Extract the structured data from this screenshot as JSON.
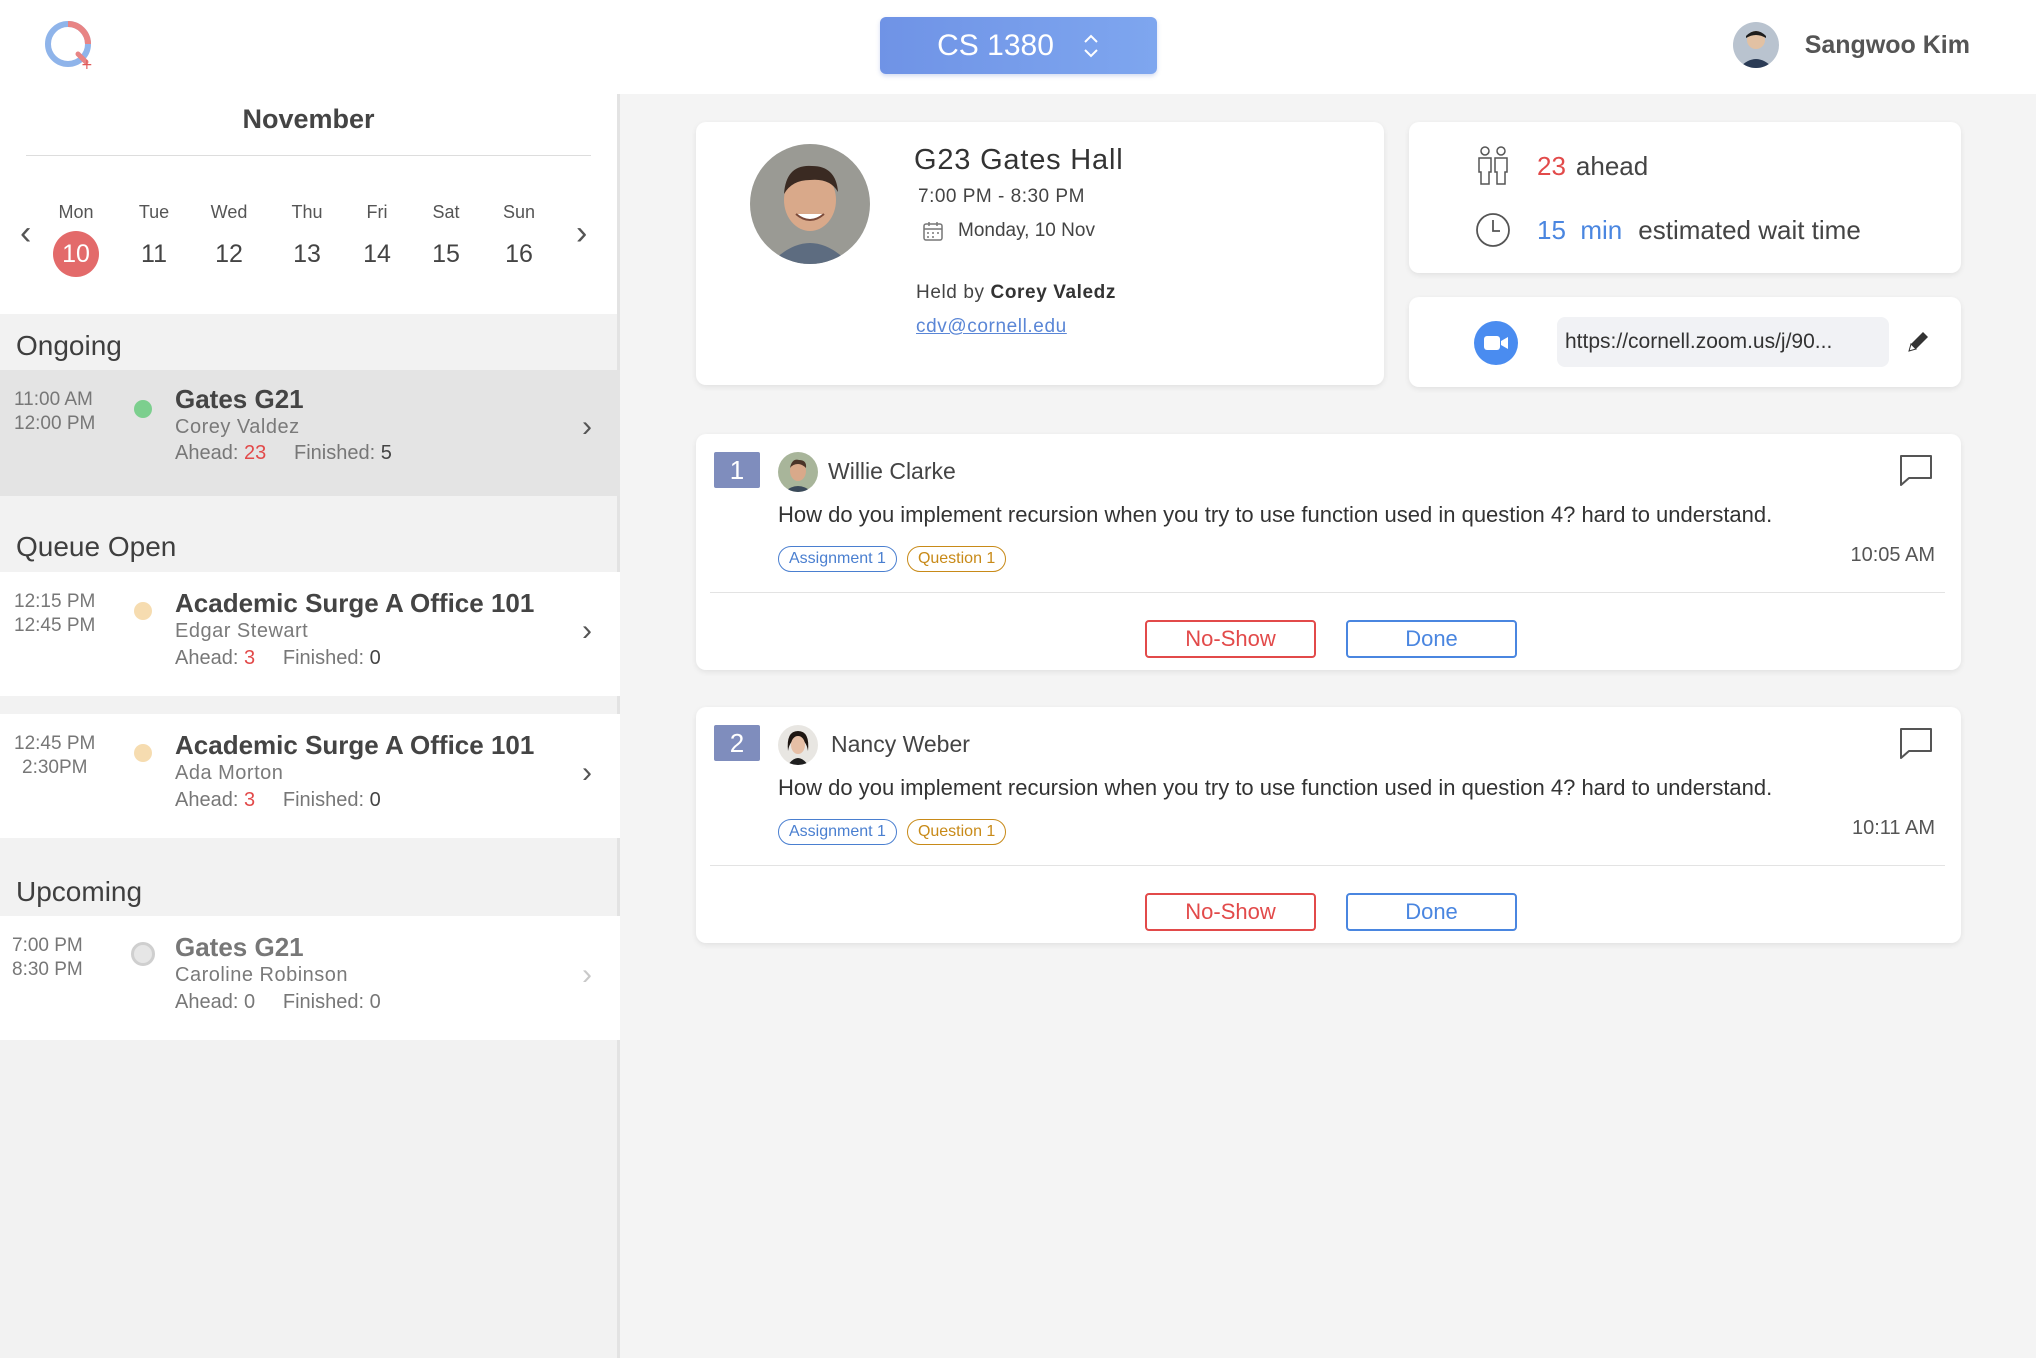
{
  "header": {
    "course": "CS 1380",
    "user_name": "Sangwoo Kim"
  },
  "calendar": {
    "month": "November",
    "days": [
      {
        "name": "Mon",
        "date": "10",
        "selected": true
      },
      {
        "name": "Tue",
        "date": "11"
      },
      {
        "name": "Wed",
        "date": "12"
      },
      {
        "name": "Thu",
        "date": "13"
      },
      {
        "name": "Fri",
        "date": "14"
      },
      {
        "name": "Sat",
        "date": "15"
      },
      {
        "name": "Sun",
        "date": "16"
      }
    ]
  },
  "sections": {
    "ongoing": "Ongoing",
    "queue_open": "Queue Open",
    "upcoming": "Upcoming"
  },
  "slots": [
    {
      "start": "11:00 AM",
      "end": "12:00 PM",
      "location": "Gates G21",
      "ta": "Corey Valdez",
      "ahead_label": "Ahead:",
      "ahead": "23",
      "finished_label": "Finished:",
      "finished": "5",
      "status_color": "#7ccf8e"
    },
    {
      "start": "12:15 PM",
      "end": "12:45 PM",
      "location": "Academic Surge A Office 101",
      "ta": "Edgar Stewart",
      "ahead_label": "Ahead:",
      "ahead": "3",
      "finished_label": "Finished:",
      "finished": "0",
      "status_color": "#f6dcb0"
    },
    {
      "start": "12:45 PM",
      "end": "2:30PM",
      "location": "Academic Surge A Office 101",
      "ta": "Ada Morton",
      "ahead_label": "Ahead:",
      "ahead": "3",
      "finished_label": "Finished:",
      "finished": "0",
      "status_color": "#f6dcb0"
    },
    {
      "start": "7:00 PM",
      "end": "8:30 PM",
      "location": "Gates G21",
      "ta": "Caroline Robinson",
      "ahead_label": "Ahead:",
      "ahead": "0",
      "finished_label": "Finished:",
      "finished": "0",
      "status_color": "#d9d9d9"
    }
  ],
  "session": {
    "room": "G23 Gates Hall",
    "hours": "7:00 PM - 8:30 PM",
    "date": "Monday, 10 Nov",
    "held_by_label": "Held by",
    "held_by": "Corey Valedz",
    "email": "cdv@cornell.edu"
  },
  "wait": {
    "ahead_count": "23",
    "ahead_label": "ahead",
    "wait_value": "15",
    "wait_unit": "min",
    "wait_label": "estimated wait time"
  },
  "zoom": {
    "link": "https://cornell.zoom.us/j/90..."
  },
  "questions": [
    {
      "number": "1",
      "name": "Willie Clarke",
      "text": "How do you implement recursion when you try to use function used in question 4? hard to  understand.",
      "tags": [
        "Assignment 1",
        "Question 1"
      ],
      "time": "10:05 AM",
      "noshow_label": "No-Show",
      "done_label": "Done"
    },
    {
      "number": "2",
      "name": "Nancy Weber",
      "text": "How do you implement recursion when you try to use function used in question 4? hard to  understand.",
      "tags": [
        "Assignment 1",
        "Question 1"
      ],
      "time": "10:11 AM",
      "noshow_label": "No-Show",
      "done_label": "Done"
    }
  ],
  "colors": {
    "accent_blue": "#4a86e0",
    "alert_red": "#e24a4a",
    "selected_day": "#e36a6a",
    "question_number_bg": "#7f8dbd"
  },
  "icons": [
    "app-logo-icon",
    "chevron-up-down-icon",
    "chevron-left-icon",
    "chevron-right-icon",
    "status-dot-icon",
    "calendar-icon",
    "people-icon",
    "clock-icon",
    "video-camera-icon",
    "pencil-icon",
    "chat-bubble-icon"
  ]
}
